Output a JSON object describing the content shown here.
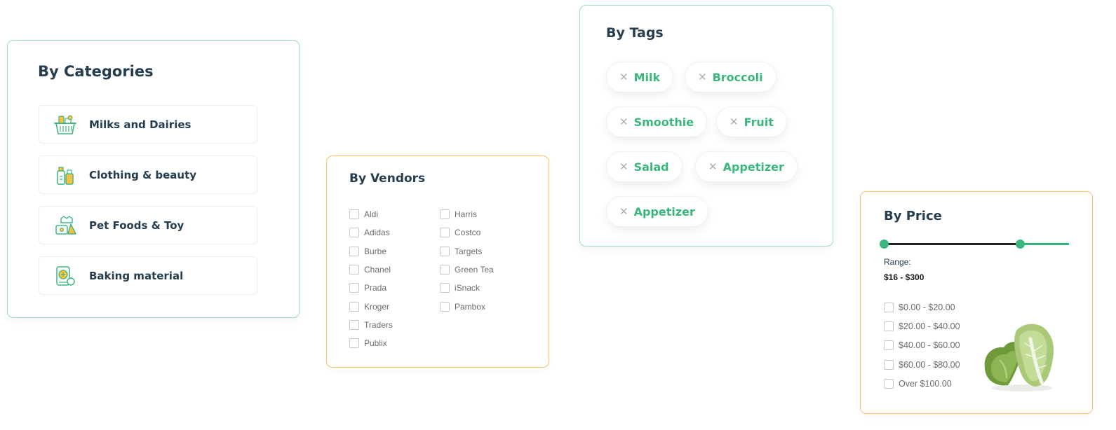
{
  "categories": {
    "title": "By Categories",
    "items": [
      {
        "label": "Milks and Dairies",
        "icon": "milk-basket-icon"
      },
      {
        "label": "Clothing & beauty",
        "icon": "bottles-icon"
      },
      {
        "label": "Pet Foods & Toy",
        "icon": "pet-food-icon"
      },
      {
        "label": "Baking material",
        "icon": "baking-icon"
      }
    ]
  },
  "vendors": {
    "title": "By Vendors",
    "column1": [
      "Aldi",
      "Adidas",
      "Burbe",
      "Chanel",
      "Prada",
      "Kroger",
      "Traders",
      "Publix"
    ],
    "column2": [
      "Harris",
      "Costco",
      "Targets",
      "Green Tea",
      "iSnack",
      "Pambox"
    ]
  },
  "tags": {
    "title": "By Tags",
    "items": [
      "Milk",
      "Broccoli",
      "Smoothie",
      "Fruit",
      "Salad",
      "Appetizer",
      "Appetizer"
    ],
    "remove_glyph": "✕"
  },
  "price": {
    "title": "By Price",
    "range_label": "Range:",
    "range_value": "$16 - $300",
    "options": [
      "$0.00 - $20.00",
      "$20.00 - $40.00",
      "$40.00 - $60.00",
      "$60.00 - $80.00",
      "Over $100.00"
    ],
    "image": "cabbage-image"
  },
  "colors": {
    "accent_green": "#3bb77e",
    "heading": "#253d4e",
    "card_border_green": "#9fdcc0",
    "card_border_yellow": "#f3c66d",
    "icon_yellow": "#fdc040"
  }
}
